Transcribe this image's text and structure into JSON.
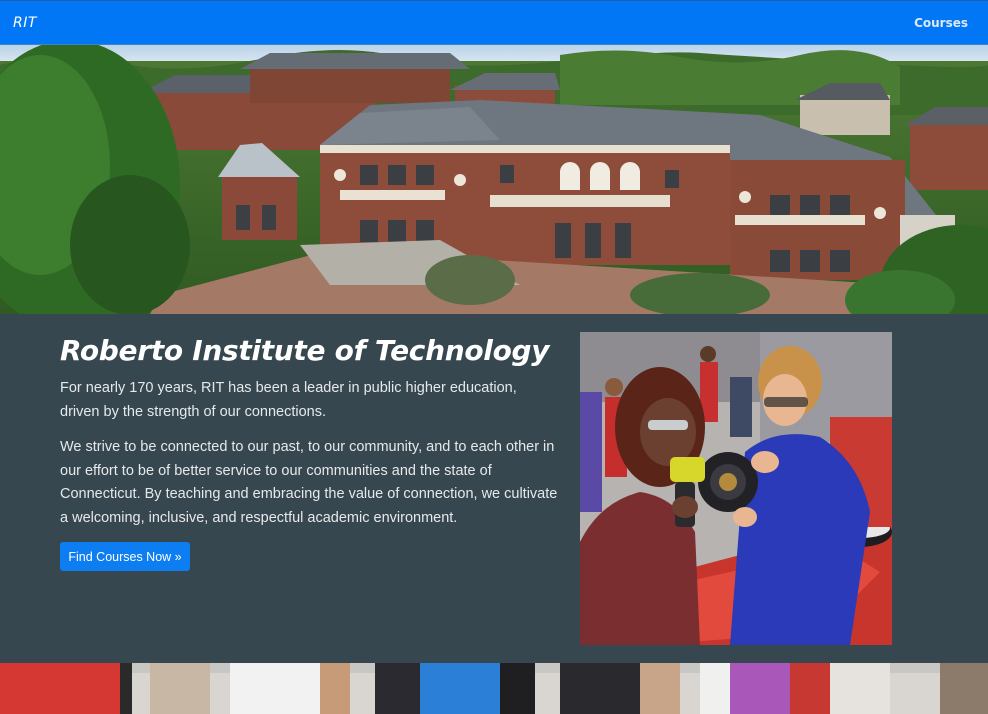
{
  "navbar": {
    "brand": "RIT",
    "links": [
      "Courses"
    ]
  },
  "hero": {
    "image": "campus-aerial-photo"
  },
  "intro": {
    "title": "Roberto Institute of Technology",
    "paragraph1": "For nearly 170 years, RIT has been a leader in public higher education, driven by the strength of our connections.",
    "paragraph2": "We strive to be connected to our past, to our community, and to each other in our effort to be of better service to our communities and the state of Connecticut. By teaching and embracing the value of connection, we cultivate a welcoming, inclusive, and respectful academic environment.",
    "cta_label": "Find Courses Now »",
    "side_image": "students-workshop-photo"
  },
  "footer_strip": {
    "image": "students-walking-photo"
  },
  "colors": {
    "navbar": "#0277f5",
    "panel": "#37474f",
    "button": "#0d7ef2"
  }
}
